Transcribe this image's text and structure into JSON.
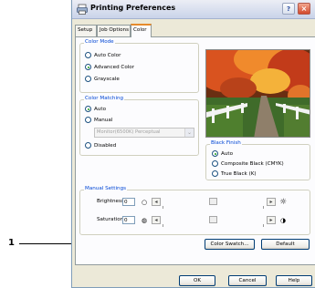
{
  "window": {
    "title": "Printing Preferences",
    "help_label": "?",
    "close_label": "×"
  },
  "tabs": [
    {
      "label": "Setup",
      "active": false
    },
    {
      "label": "Job Options",
      "active": false
    },
    {
      "label": "Color",
      "active": true
    }
  ],
  "color_mode": {
    "legend": "Color Mode",
    "options": [
      {
        "label": "Auto Color",
        "selected": false
      },
      {
        "label": "Advanced Color",
        "selected": true
      },
      {
        "label": "Grayscale",
        "selected": false
      }
    ]
  },
  "color_matching": {
    "legend": "Color Matching",
    "options": [
      {
        "label": "Auto",
        "selected": true
      },
      {
        "label": "Manual",
        "selected": false
      }
    ],
    "dropdown_value": "Monitor(6500K) Perceptual",
    "disabled_label": "Disabled"
  },
  "black_finish": {
    "legend": "Black Finish",
    "options": [
      {
        "label": "Auto",
        "selected": true
      },
      {
        "label": "Composite Black (CMYK)",
        "selected": false
      },
      {
        "label": "True Black (K)",
        "selected": false
      }
    ]
  },
  "manual_settings": {
    "legend": "Manual Settings",
    "brightness": {
      "label": "Brightness:",
      "value": "0"
    },
    "saturation": {
      "label": "Saturation:",
      "value": "0"
    }
  },
  "buttons": {
    "color_swatch": "Color Swatch...",
    "default": "Default",
    "ok": "OK",
    "cancel": "Cancel",
    "help": "Help"
  },
  "callout": {
    "number": "1"
  },
  "colors": {
    "accent_tab": "#e68b2c",
    "legend_blue": "#0046d5",
    "radio_dot": "#21a121"
  },
  "icons": {
    "app": "printer-icon",
    "brightness_low": "dim-sun-icon",
    "brightness_high": "bright-sun-icon",
    "saturation_low": "low-saturation-icon",
    "saturation_high": "high-saturation-icon"
  }
}
